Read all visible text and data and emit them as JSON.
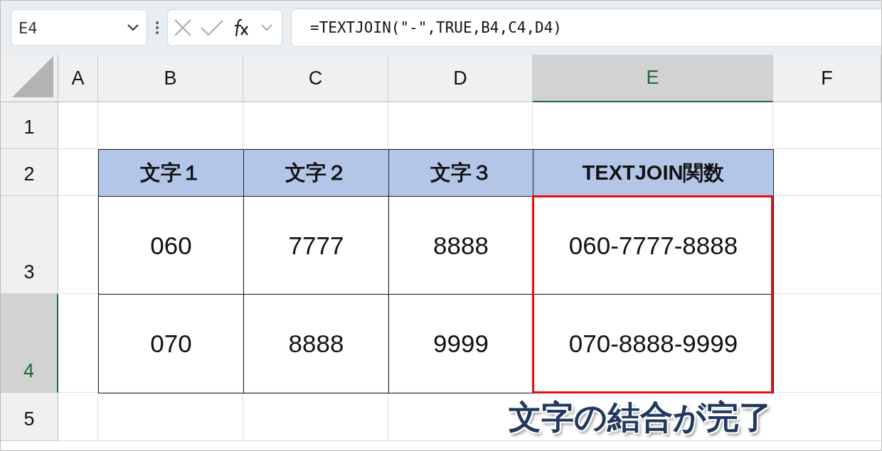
{
  "name_box": {
    "value": "E4"
  },
  "formula_bar": {
    "value": "=TEXTJOIN(\"-\",TRUE,B4,C4,D4)"
  },
  "columns": [
    {
      "label": "A",
      "selected": false
    },
    {
      "label": "B",
      "selected": false
    },
    {
      "label": "C",
      "selected": false
    },
    {
      "label": "D",
      "selected": false
    },
    {
      "label": "E",
      "selected": true
    },
    {
      "label": "F",
      "selected": false
    }
  ],
  "rows": [
    {
      "label": "1",
      "selected": false,
      "cells": []
    },
    {
      "label": "2",
      "selected": false,
      "cells": [
        {
          "text": "文字１",
          "kind": "header"
        },
        {
          "text": "文字２",
          "kind": "header"
        },
        {
          "text": "文字３",
          "kind": "header"
        },
        {
          "text": "TEXTJOIN関数",
          "kind": "header"
        }
      ]
    },
    {
      "label": "3",
      "selected": false,
      "cells": [
        {
          "text": "060",
          "kind": "value"
        },
        {
          "text": "7777",
          "kind": "value"
        },
        {
          "text": "8888",
          "kind": "value"
        },
        {
          "text": "060-7777-8888",
          "kind": "value"
        }
      ]
    },
    {
      "label": "4",
      "selected": true,
      "cells": [
        {
          "text": "070",
          "kind": "value"
        },
        {
          "text": "8888",
          "kind": "value"
        },
        {
          "text": "9999",
          "kind": "value"
        },
        {
          "text": "070-8888-9999",
          "kind": "value"
        }
      ]
    },
    {
      "label": "5",
      "selected": false,
      "cells": []
    }
  ],
  "annotation": {
    "text": "文字の結合が完了"
  }
}
